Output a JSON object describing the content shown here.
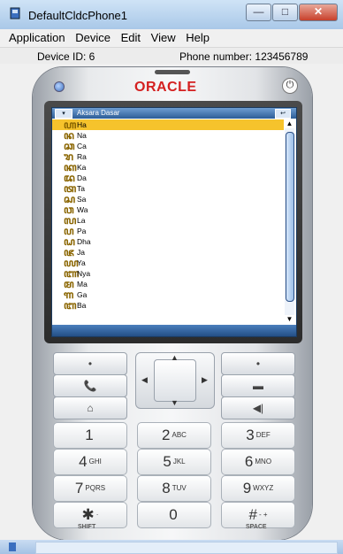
{
  "window": {
    "title": "DefaultCldcPhone1",
    "min": "—",
    "max": "□",
    "close": "✕"
  },
  "menu": {
    "items": [
      "Application",
      "Device",
      "Edit",
      "View",
      "Help"
    ]
  },
  "info": {
    "device_id": "Device ID: 6",
    "phone_number": "Phone number: 123456789"
  },
  "phone": {
    "logo": "ORACLE",
    "power_icon": "power-icon",
    "screen": {
      "title": "Aksara Dasar",
      "menu_btn": "▾",
      "back_btn": "↩",
      "items": [
        {
          "glyph": "ꦲ",
          "label": "Ha",
          "selected": true
        },
        {
          "glyph": "ꦤ",
          "label": "Na",
          "selected": false
        },
        {
          "glyph": "ꦕ",
          "label": "Ca",
          "selected": false
        },
        {
          "glyph": "ꦫ",
          "label": "Ra",
          "selected": false
        },
        {
          "glyph": "ꦏ",
          "label": "Ka",
          "selected": false
        },
        {
          "glyph": "ꦢ",
          "label": "Da",
          "selected": false
        },
        {
          "glyph": "ꦠ",
          "label": "Ta",
          "selected": false
        },
        {
          "glyph": "ꦱ",
          "label": "Sa",
          "selected": false
        },
        {
          "glyph": "ꦮ",
          "label": "Wa",
          "selected": false
        },
        {
          "glyph": "ꦭ",
          "label": "La",
          "selected": false
        },
        {
          "glyph": "ꦥ",
          "label": "Pa",
          "selected": false
        },
        {
          "glyph": "ꦝ",
          "label": "Dha",
          "selected": false
        },
        {
          "glyph": "ꦗ",
          "label": "Ja",
          "selected": false
        },
        {
          "glyph": "ꦪ",
          "label": "Ya",
          "selected": false
        },
        {
          "glyph": "ꦚ",
          "label": "Nya",
          "selected": false
        },
        {
          "glyph": "ꦩ",
          "label": "Ma",
          "selected": false
        },
        {
          "glyph": "ꦒ",
          "label": "Ga",
          "selected": false
        },
        {
          "glyph": "ꦧ",
          "label": "Ba",
          "selected": false
        }
      ]
    },
    "keys": {
      "soft_left": "•",
      "soft_right": "•",
      "call": "📞",
      "end": "▬",
      "home": "⌂",
      "clear": "◀|",
      "nav_up": "▲",
      "nav_down": "▼",
      "nav_left": "◀",
      "nav_right": "▶",
      "numbers": [
        {
          "big": "1",
          "small": ""
        },
        {
          "big": "2",
          "small": "ABC"
        },
        {
          "big": "3",
          "small": "DEF"
        },
        {
          "big": "4",
          "small": "GHI"
        },
        {
          "big": "5",
          "small": "JKL"
        },
        {
          "big": "6",
          "small": "MNO"
        },
        {
          "big": "7",
          "small": "PQRS"
        },
        {
          "big": "8",
          "small": "TUV"
        },
        {
          "big": "9",
          "small": "WXYZ"
        },
        {
          "big": "✱",
          "small": "·"
        },
        {
          "big": "0",
          "small": ""
        },
        {
          "big": "#",
          "small": "- +"
        }
      ],
      "shift_label": "SHIFT",
      "space_label": "SPACE"
    }
  }
}
